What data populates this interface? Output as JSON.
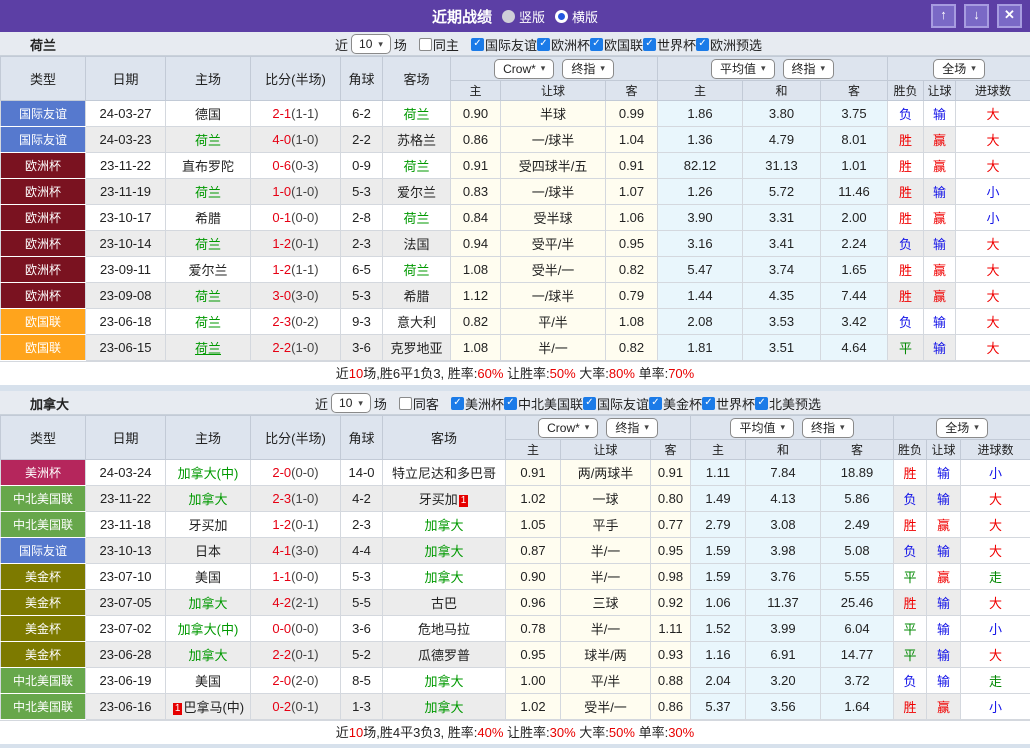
{
  "title_bar": {
    "title": "近期战绩",
    "radios": [
      {
        "label": "竖版",
        "selected": false
      },
      {
        "label": "横版",
        "selected": true
      }
    ],
    "buttons": {
      "up": "↑",
      "down": "↓",
      "close": "✕"
    }
  },
  "colors": {
    "type_badges": {
      "国际友谊": "#5679CE",
      "欧洲杯": "#7A1220",
      "欧国联": "#FFA41C",
      "美洲杯": "#B5265C",
      "中北美国联": "#67A74B",
      "美金杯": "#7D7A00"
    },
    "red": "#E80000",
    "blue": "#1414E8",
    "green": "#008800",
    "team_green": "#009900"
  },
  "table_header": {
    "left_cols": [
      "类型",
      "日期",
      "主场",
      "比分(半场)",
      "角球",
      "客场"
    ],
    "odds_select": "Crow*",
    "odds_final": "终指",
    "avg_select": "平均值",
    "avg_final": "终指",
    "scope_select": "全场",
    "odds_cols": [
      "主",
      "让球",
      "客"
    ],
    "avg_cols": [
      "主",
      "和",
      "客"
    ],
    "result_cols": [
      "胜负",
      "让球",
      "进球数"
    ]
  },
  "sections": [
    {
      "team": "荷兰",
      "filter": {
        "near": "近",
        "count": "10",
        "games": "场",
        "same": {
          "label": "同主",
          "checked": false
        },
        "leagues": [
          {
            "label": "国际友谊",
            "checked": true
          },
          {
            "label": "欧洲杯",
            "checked": true
          },
          {
            "label": "欧国联",
            "checked": true
          },
          {
            "label": "世界杯",
            "checked": true
          },
          {
            "label": "欧洲预选",
            "checked": true
          }
        ]
      },
      "rows": [
        {
          "type": "国际友谊",
          "date": "24-03-27",
          "home": {
            "name": "德国"
          },
          "score": "2-1",
          "half": "(1-1)",
          "corner": "6-2",
          "away": {
            "name": "荷兰",
            "green": true
          },
          "odds": [
            "0.90",
            "半球",
            "0.99"
          ],
          "avg": [
            "1.86",
            "3.80",
            "3.75"
          ],
          "results": [
            [
              "负",
              "b"
            ],
            [
              "输",
              "b"
            ],
            [
              "大",
              "r"
            ]
          ]
        },
        {
          "type": "国际友谊",
          "date": "24-03-23",
          "home": {
            "name": "荷兰",
            "green": true
          },
          "score": "4-0",
          "half": "(1-0)",
          "corner": "2-2",
          "away": {
            "name": "苏格兰"
          },
          "odds": [
            "0.86",
            "一/球半",
            "1.04"
          ],
          "avg": [
            "1.36",
            "4.79",
            "8.01"
          ],
          "results": [
            [
              "胜",
              "r"
            ],
            [
              "赢",
              "r"
            ],
            [
              "大",
              "r"
            ]
          ]
        },
        {
          "type": "欧洲杯",
          "date": "23-11-22",
          "home": {
            "name": "直布罗陀"
          },
          "score": "0-6",
          "half": "(0-3)",
          "corner": "0-9",
          "away": {
            "name": "荷兰",
            "green": true
          },
          "odds": [
            "0.91",
            "受四球半/五",
            "0.91"
          ],
          "avg": [
            "82.12",
            "31.13",
            "1.01"
          ],
          "results": [
            [
              "胜",
              "r"
            ],
            [
              "赢",
              "r"
            ],
            [
              "大",
              "r"
            ]
          ]
        },
        {
          "type": "欧洲杯",
          "date": "23-11-19",
          "home": {
            "name": "荷兰",
            "green": true
          },
          "score": "1-0",
          "half": "(1-0)",
          "corner": "5-3",
          "away": {
            "name": "爱尔兰"
          },
          "odds": [
            "0.83",
            "一/球半",
            "1.07"
          ],
          "avg": [
            "1.26",
            "5.72",
            "11.46"
          ],
          "results": [
            [
              "胜",
              "r"
            ],
            [
              "输",
              "b"
            ],
            [
              "小",
              "b"
            ]
          ]
        },
        {
          "type": "欧洲杯",
          "date": "23-10-17",
          "home": {
            "name": "希腊"
          },
          "score": "0-1",
          "half": "(0-0)",
          "corner": "2-8",
          "away": {
            "name": "荷兰",
            "green": true
          },
          "odds": [
            "0.84",
            "受半球",
            "1.06"
          ],
          "avg": [
            "3.90",
            "3.31",
            "2.00"
          ],
          "results": [
            [
              "胜",
              "r"
            ],
            [
              "赢",
              "r"
            ],
            [
              "小",
              "b"
            ]
          ]
        },
        {
          "type": "欧洲杯",
          "date": "23-10-14",
          "home": {
            "name": "荷兰",
            "green": true
          },
          "score": "1-2",
          "half": "(0-1)",
          "corner": "2-3",
          "away": {
            "name": "法国"
          },
          "odds": [
            "0.94",
            "受平/半",
            "0.95"
          ],
          "avg": [
            "3.16",
            "3.41",
            "2.24"
          ],
          "results": [
            [
              "负",
              "b"
            ],
            [
              "输",
              "b"
            ],
            [
              "大",
              "r"
            ]
          ]
        },
        {
          "type": "欧洲杯",
          "date": "23-09-11",
          "home": {
            "name": "爱尔兰"
          },
          "score": "1-2",
          "half": "(1-1)",
          "corner": "6-5",
          "away": {
            "name": "荷兰",
            "green": true
          },
          "odds": [
            "1.08",
            "受半/一",
            "0.82"
          ],
          "avg": [
            "5.47",
            "3.74",
            "1.65"
          ],
          "results": [
            [
              "胜",
              "r"
            ],
            [
              "赢",
              "r"
            ],
            [
              "大",
              "r"
            ]
          ]
        },
        {
          "type": "欧洲杯",
          "date": "23-09-08",
          "home": {
            "name": "荷兰",
            "green": true
          },
          "score": "3-0",
          "half": "(3-0)",
          "corner": "5-3",
          "away": {
            "name": "希腊"
          },
          "odds": [
            "1.12",
            "一/球半",
            "0.79"
          ],
          "avg": [
            "1.44",
            "4.35",
            "7.44"
          ],
          "results": [
            [
              "胜",
              "r"
            ],
            [
              "赢",
              "r"
            ],
            [
              "大",
              "r"
            ]
          ]
        },
        {
          "type": "欧国联",
          "date": "23-06-18",
          "home": {
            "name": "荷兰",
            "green": true
          },
          "score": "2-3",
          "half": "(0-2)",
          "corner": "9-3",
          "away": {
            "name": "意大利"
          },
          "odds": [
            "0.82",
            "平/半",
            "1.08"
          ],
          "avg": [
            "2.08",
            "3.53",
            "3.42"
          ],
          "results": [
            [
              "负",
              "b"
            ],
            [
              "输",
              "b"
            ],
            [
              "大",
              "r"
            ]
          ]
        },
        {
          "type": "欧国联",
          "date": "23-06-15",
          "home": {
            "name": "荷兰",
            "green": true,
            "underline": true
          },
          "score": "2-2",
          "half": "(1-0)",
          "corner": "3-6",
          "away": {
            "name": "克罗地亚"
          },
          "odds": [
            "1.08",
            "半/一",
            "0.82"
          ],
          "avg": [
            "1.81",
            "3.51",
            "4.64"
          ],
          "results": [
            [
              "平",
              "g"
            ],
            [
              "输",
              "b"
            ],
            [
              "大",
              "r"
            ]
          ]
        }
      ],
      "summary": [
        [
          "近",
          "k"
        ],
        [
          "10",
          "r"
        ],
        [
          "场,胜6平1负3, 胜率:",
          "k"
        ],
        [
          "60%",
          "r"
        ],
        [
          " 让胜率:",
          "k"
        ],
        [
          "50%",
          "r"
        ],
        [
          " 大率:",
          "k"
        ],
        [
          "80%",
          "r"
        ],
        [
          " 单率:",
          "k"
        ],
        [
          "70%",
          "r"
        ]
      ]
    },
    {
      "team": "加拿大",
      "filter": {
        "near": "近",
        "count": "10",
        "games": "场",
        "same": {
          "label": "同客",
          "checked": false
        },
        "leagues": [
          {
            "label": "美洲杯",
            "checked": true
          },
          {
            "label": "中北美国联",
            "checked": true
          },
          {
            "label": "国际友谊",
            "checked": true
          },
          {
            "label": "美金杯",
            "checked": true
          },
          {
            "label": "世界杯",
            "checked": true
          },
          {
            "label": "北美预选",
            "checked": true
          }
        ]
      },
      "rows": [
        {
          "type": "美洲杯",
          "date": "24-03-24",
          "home": {
            "name": "加拿大(中)",
            "green": true
          },
          "score": "2-0",
          "half": "(0-0)",
          "corner": "14-0",
          "away": {
            "name": "特立尼达和多巴哥"
          },
          "odds": [
            "0.91",
            "两/两球半",
            "0.91"
          ],
          "avg": [
            "1.11",
            "7.84",
            "18.89"
          ],
          "results": [
            [
              "胜",
              "r"
            ],
            [
              "输",
              "b"
            ],
            [
              "小",
              "b"
            ]
          ]
        },
        {
          "type": "中北美国联",
          "date": "23-11-22",
          "home": {
            "name": "加拿大",
            "green": true
          },
          "score": "2-3",
          "half": "(1-0)",
          "corner": "4-2",
          "away": {
            "name": "牙买加",
            "card": "1",
            "card_pos": "after"
          },
          "odds": [
            "1.02",
            "一球",
            "0.80"
          ],
          "avg": [
            "1.49",
            "4.13",
            "5.86"
          ],
          "results": [
            [
              "负",
              "b"
            ],
            [
              "输",
              "b"
            ],
            [
              "大",
              "r"
            ]
          ]
        },
        {
          "type": "中北美国联",
          "date": "23-11-18",
          "home": {
            "name": "牙买加"
          },
          "score": "1-2",
          "half": "(0-1)",
          "corner": "2-3",
          "away": {
            "name": "加拿大",
            "green": true
          },
          "odds": [
            "1.05",
            "平手",
            "0.77"
          ],
          "avg": [
            "2.79",
            "3.08",
            "2.49"
          ],
          "results": [
            [
              "胜",
              "r"
            ],
            [
              "赢",
              "r"
            ],
            [
              "大",
              "r"
            ]
          ]
        },
        {
          "type": "国际友谊",
          "date": "23-10-13",
          "home": {
            "name": "日本"
          },
          "score": "4-1",
          "half": "(3-0)",
          "corner": "4-4",
          "away": {
            "name": "加拿大",
            "green": true
          },
          "odds": [
            "0.87",
            "半/一",
            "0.95"
          ],
          "avg": [
            "1.59",
            "3.98",
            "5.08"
          ],
          "results": [
            [
              "负",
              "b"
            ],
            [
              "输",
              "b"
            ],
            [
              "大",
              "r"
            ]
          ]
        },
        {
          "type": "美金杯",
          "date": "23-07-10",
          "home": {
            "name": "美国"
          },
          "score": "1-1",
          "half": "(0-0)",
          "corner": "5-3",
          "away": {
            "name": "加拿大",
            "green": true
          },
          "odds": [
            "0.90",
            "半/一",
            "0.98"
          ],
          "avg": [
            "1.59",
            "3.76",
            "5.55"
          ],
          "results": [
            [
              "平",
              "g"
            ],
            [
              "赢",
              "r"
            ],
            [
              "走",
              "g"
            ]
          ]
        },
        {
          "type": "美金杯",
          "date": "23-07-05",
          "home": {
            "name": "加拿大",
            "green": true
          },
          "score": "4-2",
          "half": "(2-1)",
          "corner": "5-5",
          "away": {
            "name": "古巴"
          },
          "odds": [
            "0.96",
            "三球",
            "0.92"
          ],
          "avg": [
            "1.06",
            "11.37",
            "25.46"
          ],
          "results": [
            [
              "胜",
              "r"
            ],
            [
              "输",
              "b"
            ],
            [
              "大",
              "r"
            ]
          ]
        },
        {
          "type": "美金杯",
          "date": "23-07-02",
          "home": {
            "name": "加拿大(中)",
            "green": true
          },
          "score": "0-0",
          "half": "(0-0)",
          "corner": "3-6",
          "away": {
            "name": "危地马拉"
          },
          "odds": [
            "0.78",
            "半/一",
            "1.11"
          ],
          "avg": [
            "1.52",
            "3.99",
            "6.04"
          ],
          "results": [
            [
              "平",
              "g"
            ],
            [
              "输",
              "b"
            ],
            [
              "小",
              "b"
            ]
          ]
        },
        {
          "type": "美金杯",
          "date": "23-06-28",
          "home": {
            "name": "加拿大",
            "green": true
          },
          "score": "2-2",
          "half": "(0-1)",
          "corner": "5-2",
          "away": {
            "name": "瓜德罗普"
          },
          "odds": [
            "0.95",
            "球半/两",
            "0.93"
          ],
          "avg": [
            "1.16",
            "6.91",
            "14.77"
          ],
          "results": [
            [
              "平",
              "g"
            ],
            [
              "输",
              "b"
            ],
            [
              "大",
              "r"
            ]
          ]
        },
        {
          "type": "中北美国联",
          "date": "23-06-19",
          "home": {
            "name": "美国"
          },
          "score": "2-0",
          "half": "(2-0)",
          "corner": "8-5",
          "away": {
            "name": "加拿大",
            "green": true
          },
          "odds": [
            "1.00",
            "平/半",
            "0.88"
          ],
          "avg": [
            "2.04",
            "3.20",
            "3.72"
          ],
          "results": [
            [
              "负",
              "b"
            ],
            [
              "输",
              "b"
            ],
            [
              "走",
              "g"
            ]
          ]
        },
        {
          "type": "中北美国联",
          "date": "23-06-16",
          "home": {
            "name": "巴拿马(中)",
            "card": "1",
            "card_pos": "before"
          },
          "score": "0-2",
          "half": "(0-1)",
          "corner": "1-3",
          "away": {
            "name": "加拿大",
            "green": true
          },
          "odds": [
            "1.02",
            "受半/一",
            "0.86"
          ],
          "avg": [
            "5.37",
            "3.56",
            "1.64"
          ],
          "results": [
            [
              "胜",
              "r"
            ],
            [
              "赢",
              "r"
            ],
            [
              "小",
              "b"
            ]
          ]
        }
      ],
      "summary": [
        [
          "近",
          "k"
        ],
        [
          "10",
          "r"
        ],
        [
          "场,胜4平3负3, 胜率:",
          "k"
        ],
        [
          "40%",
          "r"
        ],
        [
          " 让胜率:",
          "k"
        ],
        [
          "30%",
          "r"
        ],
        [
          " 大率:",
          "k"
        ],
        [
          "50%",
          "r"
        ],
        [
          " 单率:",
          "k"
        ],
        [
          "30%",
          "r"
        ]
      ]
    }
  ]
}
